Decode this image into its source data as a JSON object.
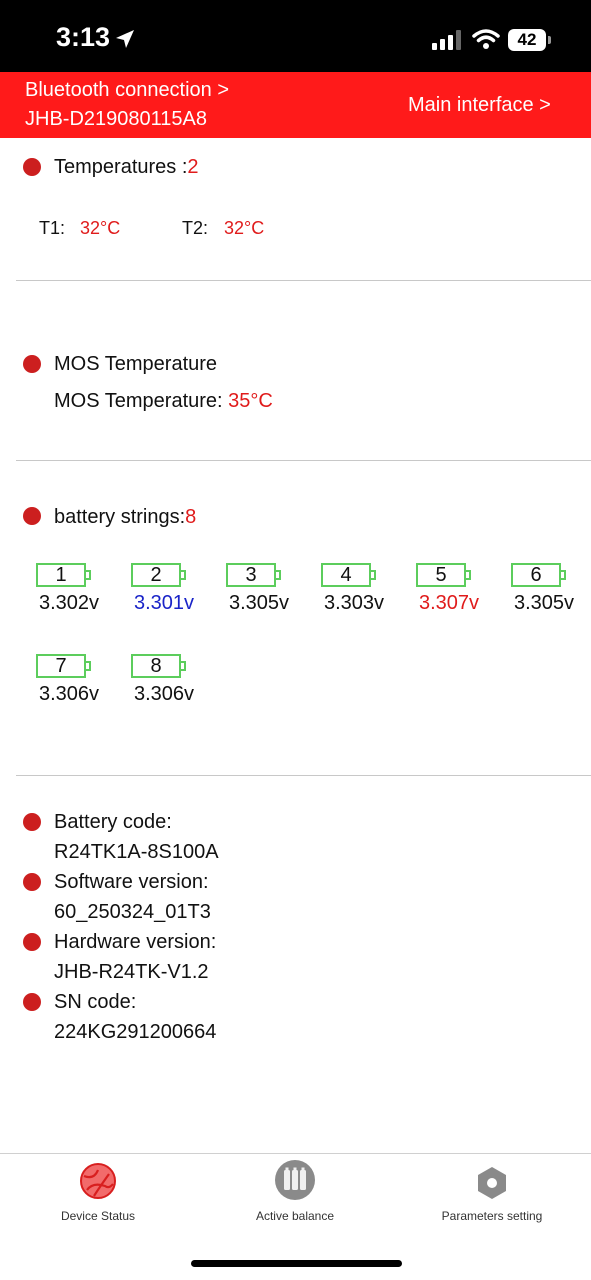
{
  "status_bar": {
    "time": "3:13",
    "battery_level": "42"
  },
  "header": {
    "bluetooth_label": "Bluetooth connection >",
    "device_id": "JHB-D219080115A8",
    "main_interface_link": "Main interface >"
  },
  "temperatures": {
    "label": "Temperatures :",
    "count": "2",
    "t1_label": "T1:",
    "t1_value": "32°C",
    "t2_label": "T2:",
    "t2_value": "32°C"
  },
  "mos": {
    "title": "MOS Temperature",
    "label": "MOS Temperature:",
    "value": "35°C"
  },
  "strings": {
    "label": "battery strings:",
    "count": "8",
    "cells": [
      {
        "num": "1",
        "volt": "3.302v",
        "color": "#111111"
      },
      {
        "num": "2",
        "volt": "3.301v",
        "color": "#1a24c8"
      },
      {
        "num": "3",
        "volt": "3.305v",
        "color": "#111111"
      },
      {
        "num": "4",
        "volt": "3.303v",
        "color": "#111111"
      },
      {
        "num": "5",
        "volt": "3.307v",
        "color": "#e01b1b"
      },
      {
        "num": "6",
        "volt": "3.305v",
        "color": "#111111"
      },
      {
        "num": "7",
        "volt": "3.306v",
        "color": "#111111"
      },
      {
        "num": "8",
        "volt": "3.306v",
        "color": "#111111"
      }
    ]
  },
  "info": {
    "battery_code_label": "Battery code:",
    "battery_code": "R24TK1A-8S100A",
    "software_label": "Software version:",
    "software": "60_250324_01T3",
    "hardware_label": "Hardware version:",
    "hardware": "JHB-R24TK-V1.2",
    "sn_label": "SN code:",
    "sn": "224KG291200664"
  },
  "tabs": [
    {
      "label": "Device Status",
      "icon": "device-status-icon"
    },
    {
      "label": "Active balance",
      "icon": "active-balance-icon"
    },
    {
      "label": "Parameters setting",
      "icon": "parameters-setting-icon"
    }
  ]
}
